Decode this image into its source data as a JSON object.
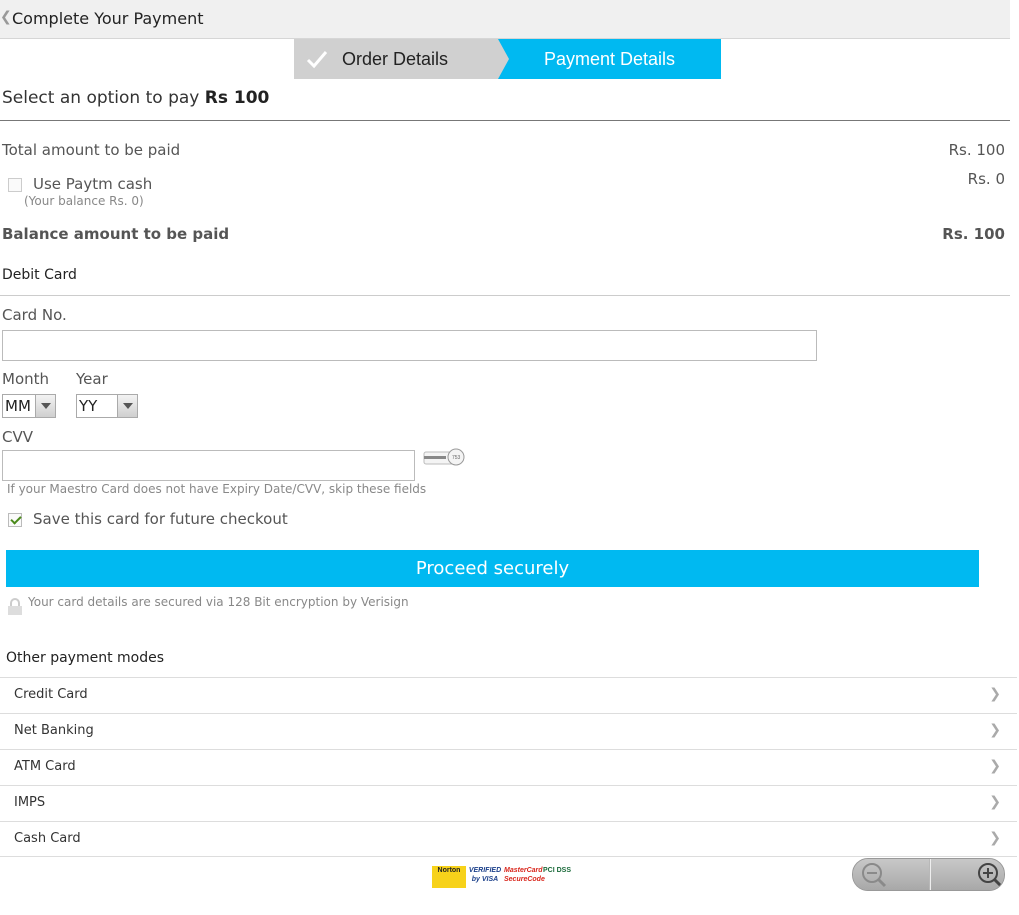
{
  "header": {
    "title": "Complete Your Payment"
  },
  "steps": {
    "step1": "Order Details",
    "step2": "Payment Details"
  },
  "select_prompt": {
    "text": "Select an option to pay ",
    "amount": "Rs 100"
  },
  "summary": {
    "total_label": "Total amount to be paid",
    "total_value": "Rs. 100",
    "paytm_label": "Use Paytm cash",
    "paytm_value": "Rs. 0",
    "paytm_balance": "(Your balance Rs. 0)",
    "balance_label": "Balance amount to be paid",
    "balance_value": "Rs. 100"
  },
  "debit_card": {
    "section_title": "Debit Card",
    "card_no_label": "Card No.",
    "card_no_value": "",
    "month_label": "Month",
    "month_value": "MM",
    "year_label": "Year",
    "year_value": "YY",
    "cvv_label": "CVV",
    "cvv_value": "",
    "maestro_note": "If your Maestro Card does not have Expiry Date/CVV, skip these fields",
    "save_label": "Save this card for future checkout",
    "save_checked": true,
    "proceed_label": "Proceed securely",
    "secure_note": "Your card details are secured via 128 Bit encryption by Verisign"
  },
  "other_modes": {
    "title": "Other payment modes",
    "items": [
      "Credit Card",
      "Net Banking",
      "ATM Card",
      "IMPS",
      "Cash Card"
    ]
  },
  "badges": [
    "Norton",
    "VERIFIED by VISA",
    "MasterCard SecureCode",
    "PCI DSS"
  ],
  "colors": {
    "accent": "#00b9f1",
    "step_inactive": "#d0d0d0"
  }
}
